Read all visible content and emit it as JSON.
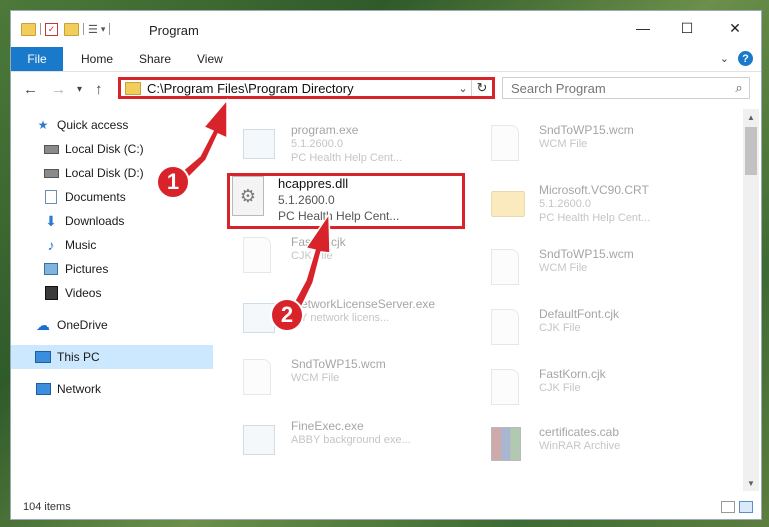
{
  "window": {
    "title": "Program"
  },
  "ribbon": {
    "tabs": [
      "File",
      "Home",
      "Share",
      "View"
    ],
    "help": "?"
  },
  "address": {
    "path": "C:\\Program Files\\Program Directory",
    "refresh": "↻"
  },
  "search": {
    "placeholder": "Search Program"
  },
  "sidebar": {
    "items": [
      {
        "label": "Quick access"
      },
      {
        "label": "Local Disk (C:)"
      },
      {
        "label": "Local Disk (D:)"
      },
      {
        "label": "Documents"
      },
      {
        "label": "Downloads"
      },
      {
        "label": "Music"
      },
      {
        "label": "Pictures"
      },
      {
        "label": "Videos"
      },
      {
        "label": "OneDrive"
      },
      {
        "label": "This PC"
      },
      {
        "label": "Network"
      }
    ]
  },
  "files": {
    "left": [
      {
        "name": "program.exe",
        "line1": "5.1.2600.0",
        "line2": "PC Health Help Cent..."
      },
      {
        "name": "Fast...t.cjk",
        "line1": "CJK File",
        "line2": ""
      },
      {
        "name": "...etworkLicenseServer.exe",
        "line1": "...Y network licens...",
        "line2": ""
      },
      {
        "name": "SndToWP15.wcm",
        "line1": "WCM File",
        "line2": ""
      },
      {
        "name": "FineExec.exe",
        "line1": "ABBY background exe...",
        "line2": ""
      }
    ],
    "right": [
      {
        "name": "SndToWP15.wcm",
        "line1": "WCM File",
        "line2": ""
      },
      {
        "name": "Microsoft.VC90.CRT",
        "line1": "5.1.2600.0",
        "line2": "PC Health Help Cent..."
      },
      {
        "name": "SndToWP15.wcm",
        "line1": "WCM File",
        "line2": ""
      },
      {
        "name": "DefaultFont.cjk",
        "line1": "CJK File",
        "line2": ""
      },
      {
        "name": "FastKorn.cjk",
        "line1": "CJK File",
        "line2": ""
      },
      {
        "name": "certificates.cab",
        "line1": "WinRAR Archive",
        "line2": ""
      }
    ],
    "highlighted": {
      "name": "hcappres.dll",
      "version": "5.1.2600.0",
      "description": "PC Health Help Cent..."
    }
  },
  "status": {
    "count": "104 items"
  },
  "callouts": {
    "one": "1",
    "two": "2"
  }
}
